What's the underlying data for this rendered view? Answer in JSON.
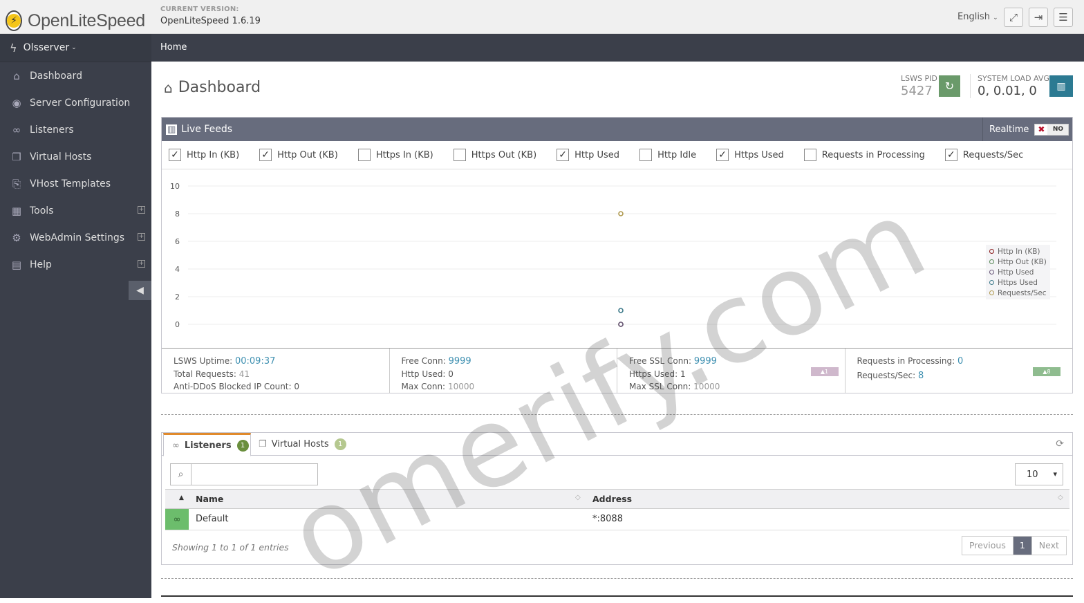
{
  "header": {
    "logo_text": "OpenLiteSpeed",
    "version_label": "CURRENT VERSION:",
    "version_value": "OpenLiteSpeed 1.6.19",
    "language": "English",
    "buttons": {
      "fullscreen_icon": "expand-icon",
      "logout_icon": "sign-out-icon",
      "menu_icon": "hamburger-icon"
    }
  },
  "sidebar": {
    "server_name": "Olsserver",
    "items": [
      {
        "label": "Dashboard",
        "icon": "home-icon",
        "expandable": false
      },
      {
        "label": "Server Configuration",
        "icon": "globe-icon",
        "expandable": false
      },
      {
        "label": "Listeners",
        "icon": "link-icon",
        "expandable": false
      },
      {
        "label": "Virtual Hosts",
        "icon": "cubes-icon",
        "expandable": false
      },
      {
        "label": "VHost Templates",
        "icon": "copy-icon",
        "expandable": false
      },
      {
        "label": "Tools",
        "icon": "grid-icon",
        "expandable": true
      },
      {
        "label": "WebAdmin Settings",
        "icon": "gear-icon",
        "expandable": true
      },
      {
        "label": "Help",
        "icon": "book-icon",
        "expandable": true
      }
    ]
  },
  "breadcrumb": {
    "home": "Home"
  },
  "page": {
    "title": "Dashboard",
    "pid_label": "LSWS PID",
    "pid_value": "5427",
    "load_label": "SYSTEM LOAD AVG",
    "load_value": "0, 0.01, 0"
  },
  "live_feeds": {
    "title": "Live Feeds",
    "realtime_label": "Realtime",
    "realtime_toggle": "NO",
    "checkboxes": [
      {
        "label": "Http In (KB)",
        "checked": true
      },
      {
        "label": "Http Out (KB)",
        "checked": true
      },
      {
        "label": "Https In (KB)",
        "checked": false
      },
      {
        "label": "Https Out (KB)",
        "checked": false
      },
      {
        "label": "Http Used",
        "checked": true
      },
      {
        "label": "Http Idle",
        "checked": false
      },
      {
        "label": "Https Used",
        "checked": true
      },
      {
        "label": "Requests in Processing",
        "checked": false
      },
      {
        "label": "Requests/Sec",
        "checked": true
      }
    ],
    "stats": {
      "uptime_label": "LSWS Uptime:",
      "uptime_value": "00:09:37",
      "total_req_label": "Total Requests:",
      "total_req_value": "41",
      "ddos_label": "Anti-DDoS Blocked IP Count:",
      "ddos_value": "0",
      "free_conn_label": "Free Conn:",
      "free_conn_value": "9999",
      "http_used_label": "Http Used:",
      "http_used_value": "0",
      "max_conn_label": "Max Conn:",
      "max_conn_value": "10000",
      "free_ssl_label": "Free SSL Conn:",
      "free_ssl_value": "9999",
      "https_used_label": "Https Used:",
      "https_used_value": "1",
      "max_ssl_label": "Max SSL Conn:",
      "max_ssl_value": "10000",
      "https_badge": "▲1",
      "req_proc_label": "Requests in Processing:",
      "req_proc_value": "0",
      "req_sec_label": "Requests/Sec:",
      "req_sec_value": "8",
      "req_badge": "▲8"
    }
  },
  "chart_data": {
    "type": "scatter",
    "ylim": [
      0,
      10
    ],
    "yticks": [
      "10",
      "8",
      "6",
      "4",
      "2",
      "0"
    ],
    "series": [
      {
        "name": "Http In (KB)",
        "color": "#8b1c1c",
        "values": [
          0
        ]
      },
      {
        "name": "Http Out (KB)",
        "color": "#5a8a5a",
        "values": [
          0
        ]
      },
      {
        "name": "Http Used",
        "color": "#6b5a7a",
        "values": [
          0
        ]
      },
      {
        "name": "Https Used",
        "color": "#3d7a8a",
        "values": [
          1
        ]
      },
      {
        "name": "Requests/Sec",
        "color": "#b09a50",
        "values": [
          8
        ]
      }
    ],
    "legend_position": "top-right"
  },
  "listeners_panel": {
    "tabs": [
      {
        "label": "Listeners",
        "count": "1",
        "active": true
      },
      {
        "label": "Virtual Hosts",
        "count": "1",
        "active": false
      }
    ],
    "search_placeholder": "",
    "page_size": "10",
    "columns": [
      "Name",
      "Address"
    ],
    "rows": [
      {
        "name": "Default",
        "address": "*:8088"
      }
    ],
    "showing": "Showing 1 to 1 of 1 entries",
    "pager": {
      "prev": "Previous",
      "current": "1",
      "next": "Next"
    }
  },
  "watermark": "omerify.com"
}
